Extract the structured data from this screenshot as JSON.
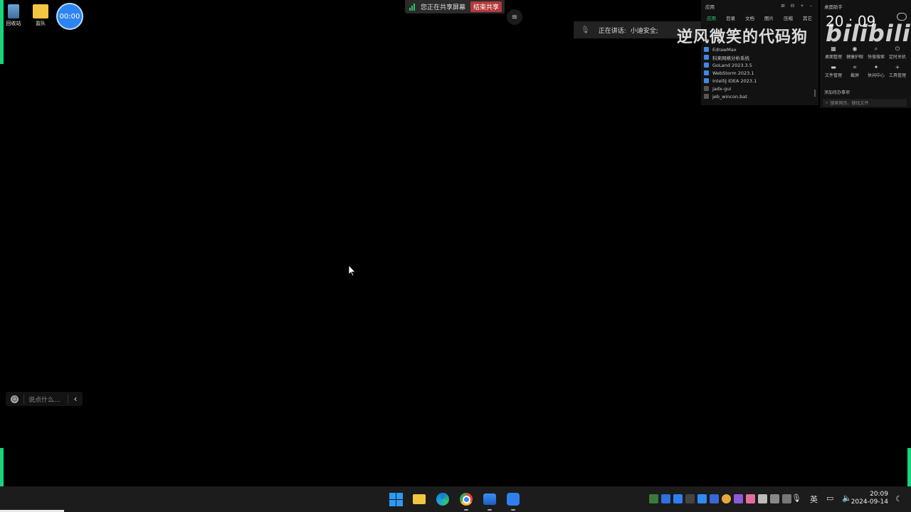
{
  "desktop": {
    "icons": [
      {
        "label": "回收站",
        "icon": "recycle-bin-icon"
      },
      {
        "label": "监队",
        "icon": "folder-icon"
      }
    ],
    "timer": "00:00"
  },
  "share_bar": {
    "status": "您正在共享屏幕",
    "stop_label": "结束共享"
  },
  "speaking": {
    "label": "正在讲话:",
    "speaker": "小迪安全;"
  },
  "watermark": {
    "text": "逆风微笑的代码狗",
    "logo": "bilibili"
  },
  "launcher": {
    "title": "应用",
    "controls": "⊞ ⊟ + –",
    "tabs": [
      "应用",
      "目录",
      "文档",
      "图片",
      "压缩",
      "其它"
    ],
    "active_tab": "应用",
    "apps": [
      {
        "name": "EdrawMax"
      },
      {
        "name": "科来网络分析系统"
      },
      {
        "name": "GoLand 2023.3.5"
      },
      {
        "name": "WebStorm 2023.1"
      },
      {
        "name": "IntelliJ IDEA 2023.1"
      },
      {
        "name": "jadx-gui"
      },
      {
        "name": "jeb_wincon.bat"
      }
    ]
  },
  "assistant": {
    "title": "桌面助手",
    "clock": "20 : 09",
    "tools": [
      {
        "label": "桌面整理",
        "glyph": "▦"
      },
      {
        "label": "健康护眼",
        "glyph": "◉"
      },
      {
        "label": "快搜搜索",
        "glyph": "⌕"
      },
      {
        "label": "定时关机",
        "glyph": "⏻"
      },
      {
        "label": "文件管理",
        "glyph": "▬"
      },
      {
        "label": "截屏",
        "glyph": "⌗"
      },
      {
        "label": "休闲中心",
        "glyph": "✦"
      },
      {
        "label": "工具管理",
        "glyph": "+"
      }
    ],
    "todo_label": "添加待办事项",
    "search_placeholder": "搜索网页、搜找文件"
  },
  "chat": {
    "placeholder": "说点什么..."
  },
  "taskbar": {
    "apps": [
      {
        "name": "start-button"
      },
      {
        "name": "file-explorer-icon"
      },
      {
        "name": "edge-icon"
      },
      {
        "name": "chrome-icon"
      },
      {
        "name": "photos-icon"
      },
      {
        "name": "tencent-meeting-icon"
      }
    ],
    "ime": "英",
    "time": "20:09",
    "date": "2024-09-14"
  },
  "colors": {
    "frame_green": "#18d47e",
    "accent_blue": "#2b84f0",
    "stop_red": "#b33a3a"
  }
}
